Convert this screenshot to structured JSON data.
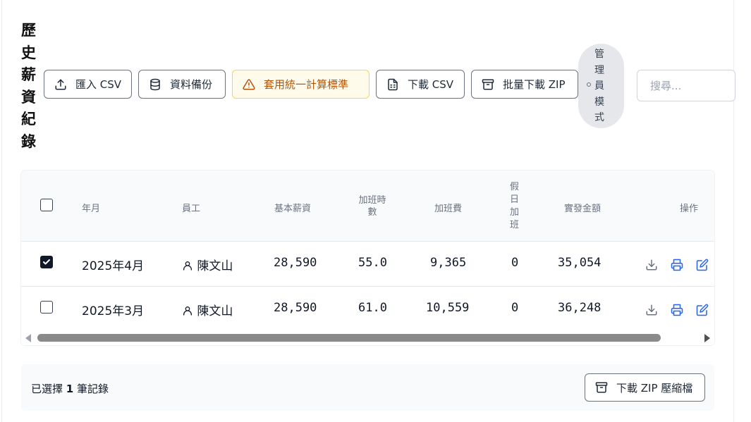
{
  "page": {
    "title": "歷史薪資紀錄"
  },
  "toolbar": {
    "import_csv": "匯入 CSV",
    "backup": "資料備份",
    "apply_standard": "套用統一計算標準",
    "download_csv": "下載 CSV",
    "bulk_zip": "批量下載 ZIP",
    "admin_mode": "管理員模式",
    "search_placeholder": "搜尋..."
  },
  "table": {
    "columns": [
      "年月",
      "員工",
      "基本薪資",
      "加班時數",
      "加班費",
      "假日加班",
      "實發金額",
      "操作"
    ],
    "rows": [
      {
        "checked": true,
        "month": "2025年4月",
        "employee": "陳文山",
        "base": "28,590",
        "ot_hours": "55.0",
        "ot_pay": "9,365",
        "holiday": "0",
        "net": "35,054"
      },
      {
        "checked": false,
        "month": "2025年3月",
        "employee": "陳文山",
        "base": "28,590",
        "ot_hours": "61.0",
        "ot_pay": "10,559",
        "holiday": "0",
        "net": "36,248"
      }
    ]
  },
  "footer": {
    "selected_prefix": "已選擇",
    "selected_count": "1",
    "selected_suffix": "筆記錄",
    "download_zip": "下載 ZIP 壓縮檔"
  },
  "colors": {
    "accent": "#2563eb",
    "warning_bg": "#fffbeb",
    "warning_border": "#fcd34d",
    "warning_text": "#b45309"
  }
}
